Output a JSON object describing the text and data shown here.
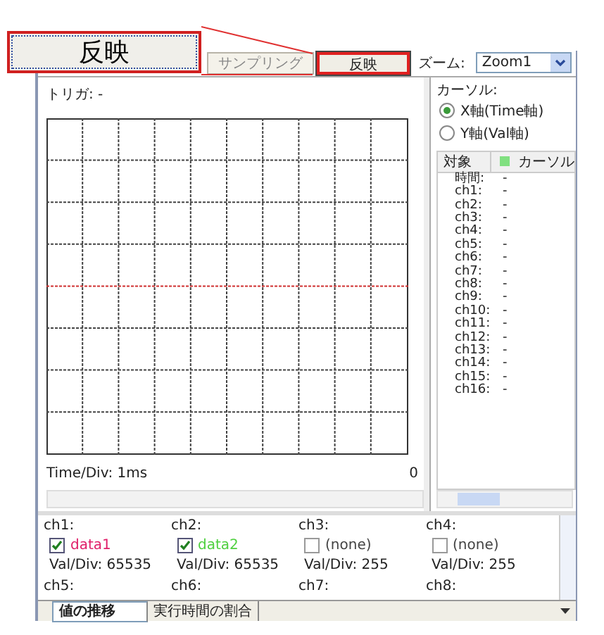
{
  "callout": {
    "label": "反映"
  },
  "toolbar": {
    "buttons": [
      {
        "label": "サンプリング",
        "highlighted": false
      },
      {
        "label": "反映",
        "highlighted": true
      }
    ],
    "zoom_label": "ズーム:",
    "zoom_value": "Zoom1"
  },
  "plot": {
    "trigger": "トリガ: -",
    "time_div": "Time/Div: 1ms",
    "axis_value": "0"
  },
  "cursor": {
    "label": "カーソル:",
    "options": [
      {
        "label": "X軸(Time軸)",
        "selected": true
      },
      {
        "label": "Y軸(Val軸)",
        "selected": false
      }
    ],
    "table": {
      "columns": [
        "対象",
        "カーソル"
      ],
      "rows": [
        {
          "name": "時間:",
          "value": "-"
        },
        {
          "name": "ch1:",
          "value": "-"
        },
        {
          "name": "ch2:",
          "value": "-"
        },
        {
          "name": "ch3:",
          "value": "-"
        },
        {
          "name": "ch4:",
          "value": "-"
        },
        {
          "name": "ch5:",
          "value": "-"
        },
        {
          "name": "ch6:",
          "value": "-"
        },
        {
          "name": "ch7:",
          "value": "-"
        },
        {
          "name": "ch8:",
          "value": "-"
        },
        {
          "name": "ch9:",
          "value": "-"
        },
        {
          "name": "ch10:",
          "value": "-"
        },
        {
          "name": "ch11:",
          "value": "-"
        },
        {
          "name": "ch12:",
          "value": "-"
        },
        {
          "name": "ch13:",
          "value": "-"
        },
        {
          "name": "ch14:",
          "value": "-"
        },
        {
          "name": "ch15:",
          "value": "-"
        },
        {
          "name": "ch16:",
          "value": "-"
        }
      ]
    }
  },
  "channels": [
    {
      "label": "ch1:",
      "checked": true,
      "name": "data1",
      "color": "#e0206a",
      "val_div": "Val/Div: 65535"
    },
    {
      "label": "ch2:",
      "checked": true,
      "name": "data2",
      "color": "#50d040",
      "val_div": "Val/Div: 65535"
    },
    {
      "label": "ch3:",
      "checked": false,
      "name": "(none)",
      "color": "#444444",
      "val_div": "Val/Div: 255"
    },
    {
      "label": "ch4:",
      "checked": false,
      "name": "(none)",
      "color": "#444444",
      "val_div": "Val/Div: 255"
    }
  ],
  "more_channels": [
    "ch5:",
    "ch6:",
    "ch7:",
    "ch8:"
  ],
  "tabs": [
    {
      "label": "値の推移",
      "selected": true
    },
    {
      "label": "実行時間の割合",
      "selected": false
    }
  ]
}
